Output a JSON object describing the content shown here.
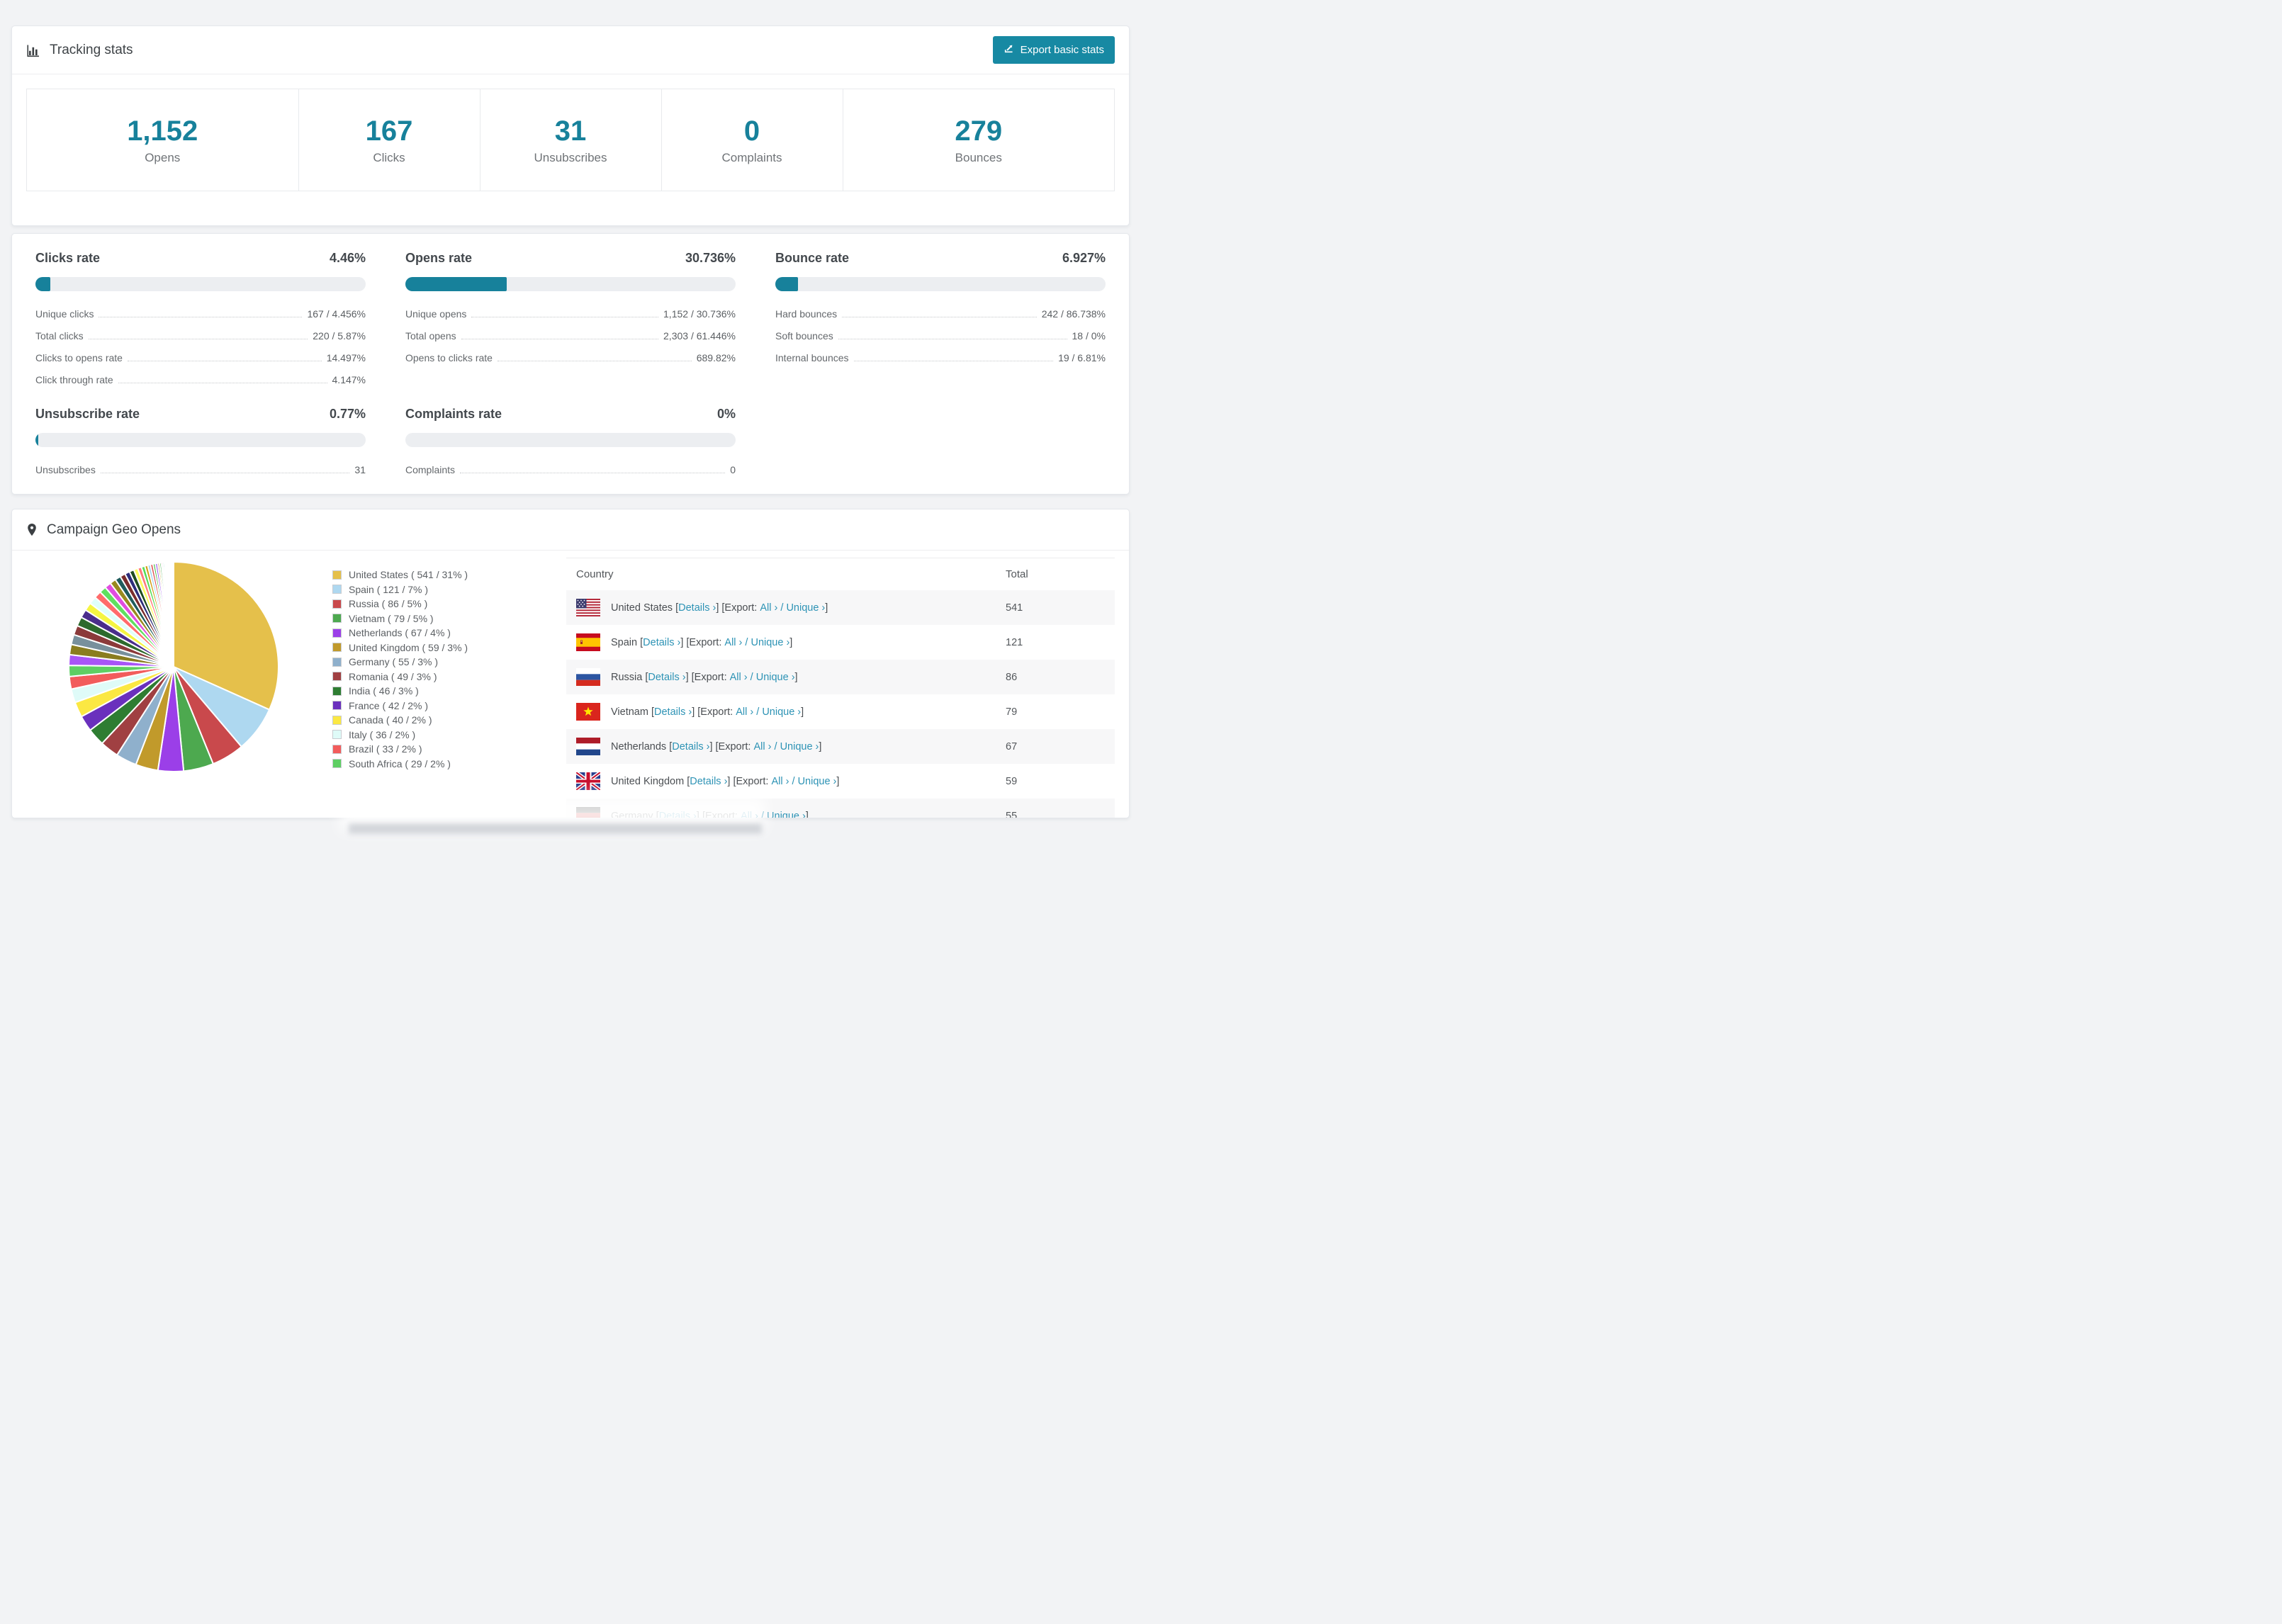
{
  "accent": "#17819B",
  "link_color": "#2D93B5",
  "icons": {
    "tracking": "bar-chart-icon",
    "export": "export-arrow-icon",
    "geo": "map-pin-icon"
  },
  "header": {
    "title": "Tracking stats",
    "export_button": "Export basic stats"
  },
  "stats": [
    {
      "value": "1,152",
      "label": "Opens"
    },
    {
      "value": "167",
      "label": "Clicks"
    },
    {
      "value": "31",
      "label": "Unsubscribes"
    },
    {
      "value": "0",
      "label": "Complaints"
    },
    {
      "value": "279",
      "label": "Bounces"
    }
  ],
  "rates": [
    {
      "title": "Clicks rate",
      "value": "4.46%",
      "percent": 4.46,
      "rows": [
        {
          "label": "Unique clicks",
          "value": "167 / 4.456%"
        },
        {
          "label": "Total clicks",
          "value": "220 / 5.87%"
        },
        {
          "label": "Clicks to opens rate",
          "value": "14.497%"
        },
        {
          "label": "Click through rate",
          "value": "4.147%"
        }
      ]
    },
    {
      "title": "Opens rate",
      "value": "30.736%",
      "percent": 30.736,
      "rows": [
        {
          "label": "Unique opens",
          "value": "1,152 / 30.736%"
        },
        {
          "label": "Total opens",
          "value": "2,303 / 61.446%"
        },
        {
          "label": "Opens to clicks rate",
          "value": "689.82%"
        }
      ]
    },
    {
      "title": "Bounce rate",
      "value": "6.927%",
      "percent": 6.927,
      "rows": [
        {
          "label": "Hard bounces",
          "value": "242 / 86.738%"
        },
        {
          "label": "Soft bounces",
          "value": "18 / 0%"
        },
        {
          "label": "Internal bounces",
          "value": "19 / 6.81%"
        }
      ]
    },
    {
      "title": "Unsubscribe rate",
      "value": "0.77%",
      "percent": 0.77,
      "rows": [
        {
          "label": "Unsubscribes",
          "value": "31"
        }
      ]
    },
    {
      "title": "Complaints rate",
      "value": "0%",
      "percent": 0,
      "rows": [
        {
          "label": "Complaints",
          "value": "0"
        }
      ]
    }
  ],
  "geo": {
    "title": "Campaign Geo Opens",
    "legend": [
      {
        "display": "United States ( 541 / 31% )",
        "color": "#E5C04B"
      },
      {
        "display": "Spain ( 121 / 7% )",
        "color": "#AED8F0"
      },
      {
        "display": "Russia ( 86 / 5% )",
        "color": "#C9494C"
      },
      {
        "display": "Vietnam ( 79 / 5% )",
        "color": "#4DA94F"
      },
      {
        "display": "Netherlands ( 67 / 4% )",
        "color": "#9B3FE8"
      },
      {
        "display": "United Kingdom ( 59 / 3% )",
        "color": "#C19A2B"
      },
      {
        "display": "Germany ( 55 / 3% )",
        "color": "#8FB0CC"
      },
      {
        "display": "Romania ( 49 / 3% )",
        "color": "#A04042"
      },
      {
        "display": "India ( 46 / 3% )",
        "color": "#2E7D32"
      },
      {
        "display": "France ( 42 / 2% )",
        "color": "#6A30BD"
      },
      {
        "display": "Canada ( 40 / 2% )",
        "color": "#FBE843"
      },
      {
        "display": "Italy ( 36 / 2% )",
        "color": "#DFFBF8"
      },
      {
        "display": "Brazil ( 33 / 2% )",
        "color": "#F25C5C"
      },
      {
        "display": "South Africa ( 29 / 2% )",
        "color": "#5ECF63"
      }
    ],
    "table": {
      "columns": [
        "Country",
        "Total"
      ],
      "link_parts": {
        "open": " [",
        "details": "Details ›",
        "mid": "] [Export: ",
        "all": "All ›",
        "slash": " / ",
        "unique": "Unique ›",
        "close": "]"
      },
      "rows": [
        {
          "flag": "us",
          "country": "United States",
          "total": "541"
        },
        {
          "flag": "es",
          "country": "Spain",
          "total": "121"
        },
        {
          "flag": "ru",
          "country": "Russia",
          "total": "86"
        },
        {
          "flag": "vn",
          "country": "Vietnam",
          "total": "79"
        },
        {
          "flag": "nl",
          "country": "Netherlands",
          "total": "67"
        },
        {
          "flag": "gb",
          "country": "United Kingdom",
          "total": "59"
        },
        {
          "flag": "de",
          "country": "Germany",
          "total": "55"
        }
      ]
    }
  },
  "chart_data": {
    "type": "pie",
    "title": "Campaign Geo Opens",
    "unit": "opens",
    "legend_position": "right",
    "categories": [
      "United States",
      "Spain",
      "Russia",
      "Vietnam",
      "Netherlands",
      "United Kingdom",
      "Germany",
      "Romania",
      "India",
      "France",
      "Canada",
      "Italy",
      "Brazil",
      "South Africa"
    ],
    "values": [
      541,
      121,
      86,
      79,
      67,
      59,
      55,
      49,
      46,
      42,
      40,
      36,
      33,
      29
    ],
    "percent_labels": [
      "31%",
      "7%",
      "5%",
      "5%",
      "4%",
      "3%",
      "3%",
      "3%",
      "3%",
      "2%",
      "2%",
      "2%",
      "2%",
      "2%"
    ],
    "colors": [
      "#E5C04B",
      "#AED8F0",
      "#C9494C",
      "#4DA94F",
      "#9B3FE8",
      "#C19A2B",
      "#8FB0CC",
      "#A04042",
      "#2E7D32",
      "#6A30BD",
      "#FBE843",
      "#DFFBF8",
      "#F25C5C",
      "#5ECF63"
    ],
    "others_unlabeled": {
      "note": "long tail of small unlabeled slices, values estimated from pixels",
      "values": [
        28,
        27,
        26,
        25,
        24,
        22,
        21,
        20,
        19,
        18,
        17,
        16,
        15,
        14,
        13,
        12,
        11,
        10,
        9,
        8,
        7,
        7,
        6,
        6,
        5,
        5,
        4,
        4,
        3,
        3,
        2,
        2,
        2,
        1,
        1,
        1,
        1,
        1,
        1,
        1,
        1,
        1,
        1,
        1,
        1
      ],
      "colors": [
        "#A855F7",
        "#8A7D1F",
        "#78909C",
        "#8B3A3A",
        "#2D6A2D",
        "#4A2D8B",
        "#F5F542",
        "#DFFFFB",
        "#FF6B6B",
        "#5FE05F",
        "#E04DE0",
        "#998A1F",
        "#1F5C5C",
        "#7A2D2D",
        "#2D2D7A",
        "#1F4D1F",
        "#FCFC60",
        "#FF7B7B",
        "#55DD55",
        "#D4A017",
        "#A0D2F0",
        "#E05555",
        "#44BB44",
        "#9955EE",
        "#C8A030",
        "#70C070",
        "#FF69B4",
        "#20B2AA",
        "#8860D0",
        "#B8860B",
        "#9ACD32",
        "#DC6ACF",
        "#5F9EA0",
        "#C06060",
        "#4682B4",
        "#7CFC00",
        "#BA55D3",
        "#CD853F",
        "#66CDAA",
        "#DDA0DD",
        "#F08080",
        "#87CEEB",
        "#90EE90",
        "#E6C14B",
        "#AED8F0"
      ]
    }
  }
}
